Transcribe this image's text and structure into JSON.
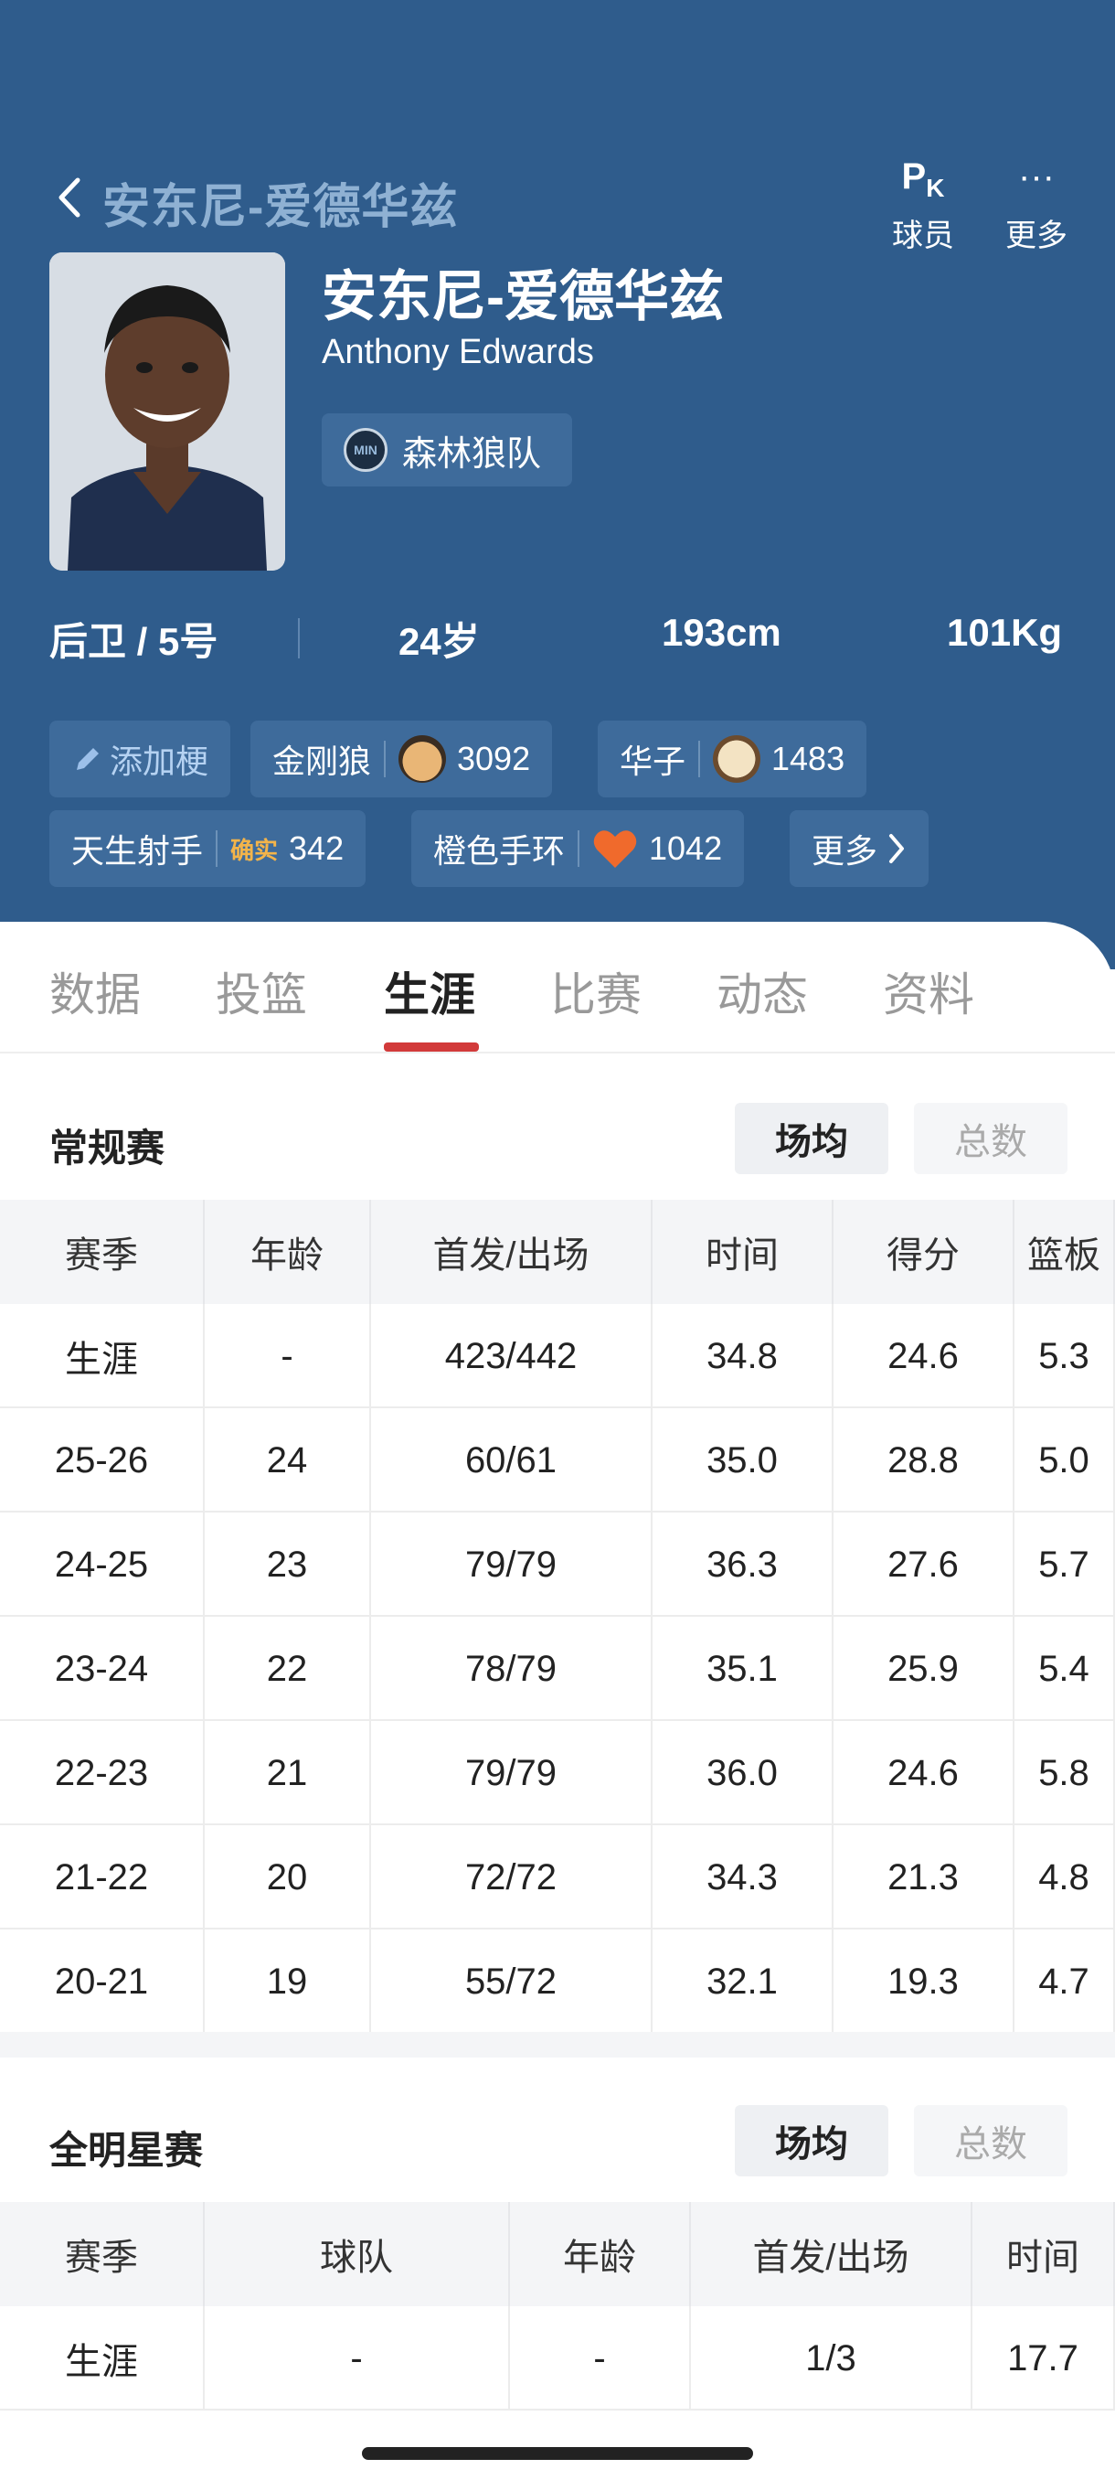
{
  "header": {
    "back_title": "安东尼-爱德华兹",
    "actions": [
      {
        "glyph": "P",
        "glyph_sub": "K",
        "label": "球员"
      },
      {
        "glyph": "···",
        "label": "更多"
      }
    ],
    "name_cn": "安东尼-爱德华兹",
    "name_en": "Anthony Edwards",
    "team": "森林狼队",
    "team_logo_text": "MIN",
    "position": "后卫 / 5号",
    "age": "24岁",
    "height": "193cm",
    "weight": "101Kg",
    "tags": [
      {
        "label": "添加梗"
      },
      {
        "label": "金刚狼",
        "count": "3092"
      },
      {
        "label": "华子",
        "count": "1483"
      },
      {
        "label": "天生射手",
        "badge": "确实",
        "count": "342"
      },
      {
        "label": "橙色手环",
        "count": "1042"
      },
      {
        "label": "更多"
      }
    ]
  },
  "tabs": [
    "数据",
    "投篮",
    "生涯",
    "比赛",
    "动态",
    "资料"
  ],
  "active_tab": "生涯",
  "regular": {
    "title": "常规赛",
    "toggle_on": "场均",
    "toggle_off": "总数",
    "columns": [
      "赛季",
      "年龄",
      "首发/出场",
      "时间",
      "得分",
      "篮板"
    ],
    "rows": [
      [
        "生涯",
        "-",
        "423/442",
        "34.8",
        "24.6",
        "5.3"
      ],
      [
        "25-26",
        "24",
        "60/61",
        "35.0",
        "28.8",
        "5.0"
      ],
      [
        "24-25",
        "23",
        "79/79",
        "36.3",
        "27.6",
        "5.7"
      ],
      [
        "23-24",
        "22",
        "78/79",
        "35.1",
        "25.9",
        "5.4"
      ],
      [
        "22-23",
        "21",
        "79/79",
        "36.0",
        "24.6",
        "5.8"
      ],
      [
        "21-22",
        "20",
        "72/72",
        "34.3",
        "21.3",
        "4.8"
      ],
      [
        "20-21",
        "19",
        "55/72",
        "32.1",
        "19.3",
        "4.7"
      ]
    ]
  },
  "allstar": {
    "title": "全明星赛",
    "toggle_on": "场均",
    "toggle_off": "总数",
    "columns": [
      "赛季",
      "球队",
      "年龄",
      "首发/出场",
      "时间"
    ],
    "rows": [
      [
        "生涯",
        "-",
        "-",
        "1/3",
        "17.7"
      ]
    ]
  },
  "colors": {
    "header_bg": "#2f5c8c",
    "accent": "#d23a3a"
  }
}
